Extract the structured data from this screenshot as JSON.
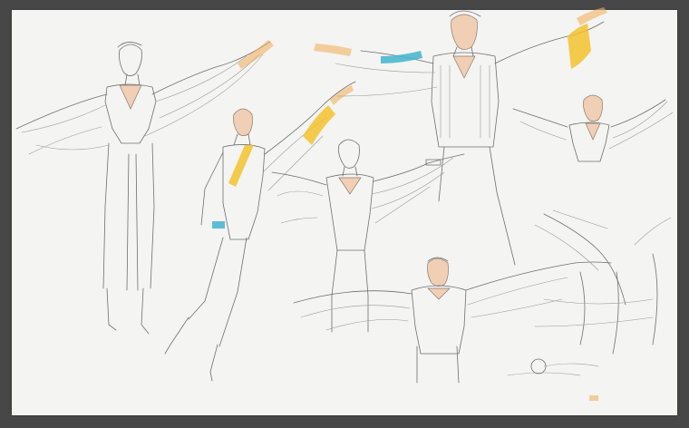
{
  "artwork": {
    "subject": "",
    "colors": {
      "background_border": "#474747",
      "paper": "#f4f4f2",
      "pencil": "#6f6f6f",
      "skin_wash": "#f0cfb5",
      "yellow_accent": "#f2c22e",
      "blue_accent": "#3fb4cf"
    }
  }
}
